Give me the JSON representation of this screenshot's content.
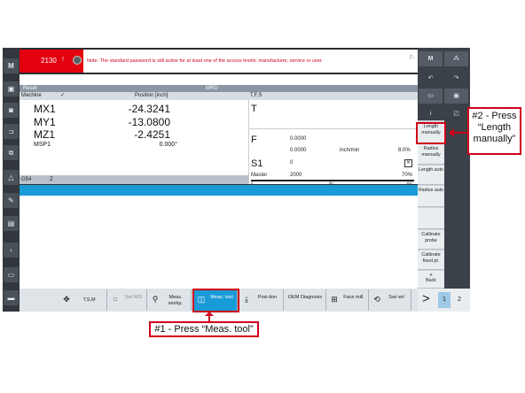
{
  "alarm": {
    "number": "2130",
    "marker": "!",
    "message": "Note: The standard password is still active for at least one of the access levels: manufacturer, service or user."
  },
  "status": {
    "reset_label": "Reset",
    "mode": "MRD"
  },
  "position_table": {
    "col_machine": "Machine",
    "col_position": "Position [inch]",
    "rows": [
      {
        "axis": "MX1",
        "value": "-24.3241"
      },
      {
        "axis": "MY1",
        "value": "-13.0800"
      },
      {
        "axis": "MZ1",
        "value": "-2.4251"
      },
      {
        "axis": "MSP1",
        "value": "0.000°"
      }
    ]
  },
  "work_offset": {
    "offset": "G54",
    "plane": "Z"
  },
  "tfs": {
    "header": "T,F,S",
    "t_label": "T",
    "f_label": "F",
    "f_value1": "0.0000",
    "f_value2": "0.0000",
    "f_unit": "inch/min",
    "f_percent": "8.0%",
    "s_label": "S1",
    "s_value": "0",
    "master_label": "Master",
    "master_value": "2000",
    "master_percent": "70%",
    "scale": [
      "0",
      "50",
      "100"
    ]
  },
  "vertical_softkeys": [
    {
      "label": "Length manually",
      "highlight": true
    },
    {
      "label": "Radius manually"
    },
    {
      "label": "Length auto"
    },
    {
      "label": "Radius auto"
    },
    {
      "label": ""
    },
    {
      "label": ""
    },
    {
      "label": "Calibrate probe"
    },
    {
      "label": "Calibrate fixed pt."
    },
    {
      "label": "Back"
    }
  ],
  "horizontal_softkeys": [
    {
      "label": "T,S,M",
      "icon": "tsm-icon"
    },
    {
      "label": "Set WO",
      "icon": "set-wo-icon"
    },
    {
      "label": "Meas. workp.",
      "icon": "measure-workpiece-icon"
    },
    {
      "label": "Meas. tool",
      "icon": "measure-tool-icon",
      "active": true
    },
    {
      "label": "Posi-tion",
      "icon": "position-icon"
    },
    {
      "label": "OEM Diagnosis",
      "icon": ""
    },
    {
      "label": "Face mill.",
      "icon": "face-mill-icon"
    },
    {
      "label": "Swi vel",
      "icon": "swivel-icon"
    }
  ],
  "pager": {
    "more": ">",
    "page1": "1",
    "page2": "2"
  },
  "annotations": {
    "step1": "#1 - Press “Meas. tool”",
    "step2": "#2 - Press “Length manually”"
  },
  "colors": {
    "accent": "#1a9bd7",
    "alarm": "#e3000f",
    "annotation": "#d0021b"
  }
}
